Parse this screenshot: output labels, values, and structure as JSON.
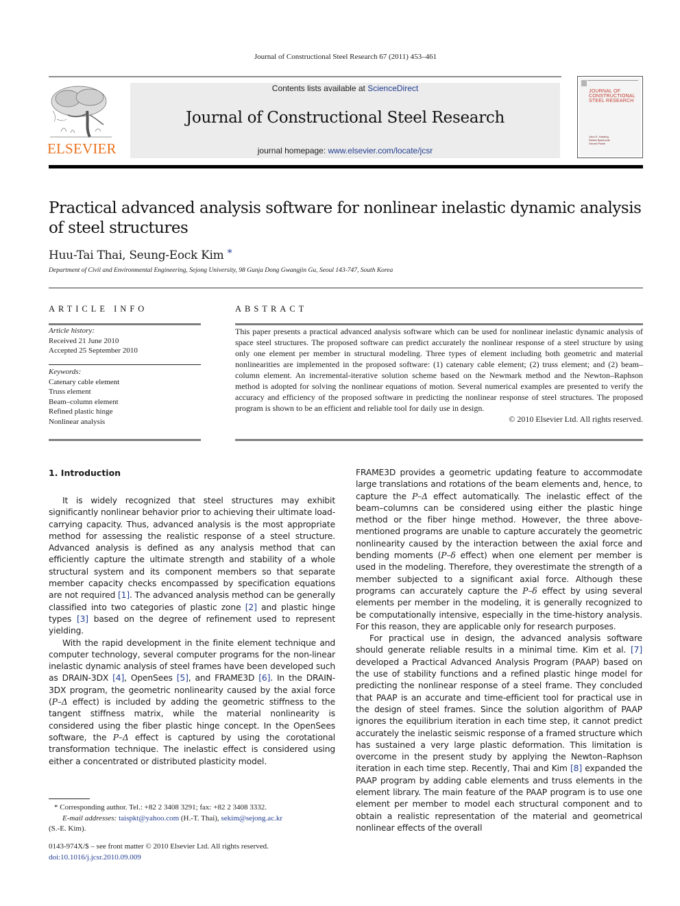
{
  "running_head": "Journal of Constructional Steel Research 67 (2011) 453–461",
  "publisher": {
    "name": "ELSEVIER",
    "logo_icon": "elsevier-tree-icon",
    "brand_color": "#e9711c"
  },
  "journal_band": {
    "contents_prefix": "Contents lists available at ",
    "contents_link": "ScienceDirect",
    "journal_title": "Journal of Constructional Steel Research",
    "homepage_prefix": "journal homepage: ",
    "homepage_link": "www.elsevier.com/locate/jcsr",
    "band_color": "#ececec",
    "link_color": "#1f3b8f"
  },
  "cover": {
    "title_lines": [
      "JOURNAL OF",
      "CONSTRUCTIONAL",
      "STEEL RESEARCH"
    ],
    "editors": [
      "John E. Harding",
      "Reidar Bjorhovde",
      "Gerard Parke"
    ]
  },
  "article": {
    "title": "Practical advanced analysis software for nonlinear inelastic dynamic analysis of steel structures",
    "authors": "Huu-Tai Thai, Seung-Eock Kim",
    "author_marker": "*",
    "affiliation": "Department of Civil and Environmental Engineering, Sejong University, 98 Gunja Dong Gwangjin Gu, Seoul 143-747, South Korea"
  },
  "article_info": {
    "heading": "ARTICLE INFO",
    "history_label": "Article history:",
    "received": "Received 21 June 2010",
    "accepted": "Accepted 25 September 2010",
    "keywords_label": "Keywords:",
    "keywords": [
      "Catenary cable element",
      "Truss element",
      "Beam–column element",
      "Refined plastic hinge",
      "Nonlinear analysis"
    ]
  },
  "abstract": {
    "heading": "ABSTRACT",
    "text": "This paper presents a practical advanced analysis software which can be used for nonlinear inelastic dynamic analysis of space steel structures. The proposed software can predict accurately the nonlinear response of a steel structure by using only one element per member in structural modeling. Three types of element including both geometric and material nonlinearities are implemented in the proposed software: (1) catenary cable element; (2) truss element; and (2) beam–column element. An incremental-iterative solution scheme based on the Newmark method and the Newton–Raphson method is adopted for solving the nonlinear equations of motion. Several numerical examples are presented to verify the accuracy and efficiency of the proposed software in predicting the nonlinear response of steel structures. The proposed program is shown to be an efficient and reliable tool for daily use in design.",
    "copyright": "© 2010 Elsevier Ltd. All rights reserved."
  },
  "section1": {
    "heading": "1.  Introduction",
    "left_p1": [
      "It is widely recognized that steel structures may exhibit significantly nonlinear behavior prior to achieving their ultimate load-carrying capacity. Thus, advanced analysis is the most appropriate method for assessing the realistic response of a steel structure. Advanced analysis is defined as any analysis method that can efficiently capture the ultimate strength and stability of a whole structural system and its component members so that separate member capacity checks encompassed by specification equations are not required ",
      "[1]",
      ". The advanced analysis method can be generally classified into two categories of plastic zone ",
      "[2]",
      " and plastic hinge types ",
      "[3]",
      " based on the degree of refinement used to represent yielding."
    ],
    "left_p2": [
      "With the rapid development in the finite element technique and computer technology, several computer programs for the non-linear inelastic dynamic analysis of steel frames have been developed such as DRAIN-3DX ",
      "[4]",
      ", OpenSees ",
      "[5]",
      ", and FRAME3D ",
      "[6]",
      ". In the DRAIN-3DX program, the geometric nonlinearity caused by the axial force (",
      "P–Δ",
      " effect) is included by adding the geometric stiffness to the tangent stiffness matrix, while the material nonlinearity is considered using the fiber plastic hinge concept. In the OpenSees software, the ",
      "P–Δ",
      " effect is captured by using the corotational transformation technique. The inelastic effect is considered using either a concentrated or distributed plasticity model."
    ],
    "right_p1": [
      "FRAME3D provides a geometric updating feature to accommodate large translations and rotations of the beam elements and, hence, to capture the ",
      "P–Δ",
      " effect automatically. The inelastic effect of the beam–columns can be considered using either the plastic hinge method or the fiber hinge method. However, the three above-mentioned programs are unable to capture accurately the geometric nonlinearity caused by the interaction between the axial force and bending moments (",
      "P–δ",
      " effect) when one element per member is used in the modeling. Therefore, they overestimate the strength of a member subjected to a significant axial force. Although these programs can accurately capture the ",
      "P–δ",
      " effect by using several elements per member in the modeling, it is generally recognized to be computationally intensive, especially in the time-history analysis. For this reason, they are applicable only for research purposes."
    ],
    "right_p2": [
      "For practical use in design, the advanced analysis software should generate reliable results in a minimal time. Kim et al. ",
      "[7]",
      " developed a Practical Advanced Analysis Program (PAAP) based on the use of stability functions and a refined plastic hinge model for predicting the nonlinear response of a steel frame. They concluded that PAAP is an accurate and time-efficient tool for practical use in the design of steel frames. Since the solution algorithm of PAAP ignores the equilibrium iteration in each time step, it cannot predict accurately the inelastic seismic response of a framed structure which has sustained a very large plastic deformation. This limitation is overcome in the present study by applying the Newton–Raphson iteration in each time step. Recently, Thai and Kim ",
      "[8]",
      " expanded the PAAP program by adding cable elements and truss elements in the element library. The main feature of the PAAP program is to use one element per member to model each structural component and to obtain a realistic representation of the material and geometrical nonlinear effects of the overall"
    ]
  },
  "footnote": {
    "marker": "*",
    "corresponding": "Corresponding author. Tel.: +82 2 3408 3291; fax: +82 2 3408 3332.",
    "email_label": "E-mail addresses:",
    "email1": "taispkt@yahoo.com",
    "email1_owner": " (H.-T. Thai), ",
    "email2": "sekim@sejong.ac.kr",
    "email2_owner": "(S.-E. Kim)."
  },
  "front_matter": {
    "issn_line": "0143-974X/$ – see front matter © 2010 Elsevier Ltd. All rights reserved.",
    "doi": "doi:10.1016/j.jcsr.2010.09.009"
  }
}
